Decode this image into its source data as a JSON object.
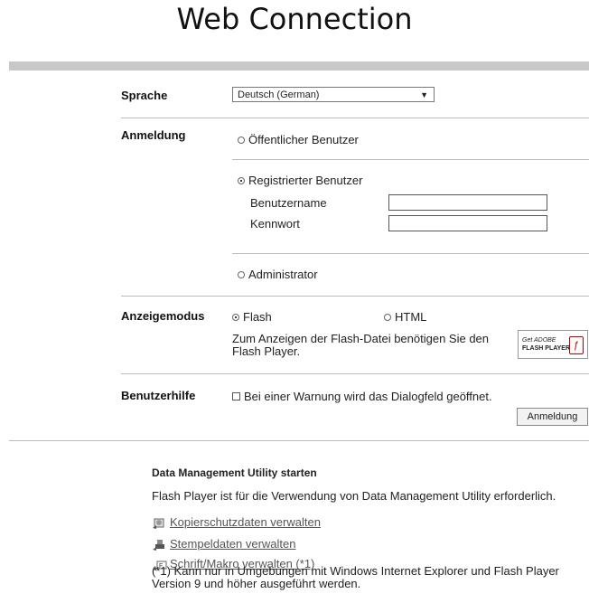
{
  "title": "Web Connection",
  "language": {
    "label": "Sprache",
    "selected": "Deutsch (German)"
  },
  "login": {
    "label": "Anmeldung",
    "public_user": "Öffentlicher Benutzer",
    "registered_user": "Registrierter Benutzer",
    "username_label": "Benutzername",
    "password_label": "Kennwort",
    "administrator": "Administrator"
  },
  "display_mode": {
    "label": "Anzeigemodus",
    "flash": "Flash",
    "html": "HTML",
    "flash_note": "Zum Anzeigen der Flash-Datei benötigen Sie den Flash Player.",
    "flash_badge_top": "Get ADOBE",
    "flash_badge_bottom": "FLASH PLAYER"
  },
  "user_help": {
    "label": "Benutzerhilfe",
    "checkbox": "Bei einer Warnung wird das Dialogfeld geöffnet."
  },
  "login_button": "Anmeldung",
  "dmu": {
    "heading": "Data Management Utility starten",
    "description": "Flash Player ist für die Verwendung von Data Management Utility erforderlich.",
    "links": [
      "Kopierschutzdaten verwalten",
      "Stempeldaten verwalten",
      "Schrift/Makro verwalten (*1)"
    ],
    "note": "(*1) Kann nur in Umgebungen mit Windows Internet Explorer und Flash Player Version 9 und höher ausgeführt werden."
  }
}
